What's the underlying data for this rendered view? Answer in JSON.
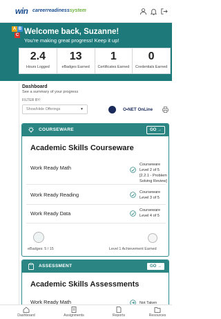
{
  "app": {
    "logo_primary": "win",
    "logo_secondary_left": "careerreadiness",
    "logo_secondary_right": "system"
  },
  "top_icons": [
    "user-icon",
    "bell-icon",
    "logout-icon"
  ],
  "welcome": {
    "title": "Welcome back, Suzanne!",
    "subtitle": "You're making great progress! Keep it up!",
    "blocks": [
      "A",
      "B",
      "C"
    ]
  },
  "stats": [
    {
      "value": "2.4",
      "label": "Hours Logged"
    },
    {
      "value": "13",
      "label": "eBadges Earned"
    },
    {
      "value": "1",
      "label": "Certificates Earned"
    },
    {
      "value": "0",
      "label": "Credentials Earned"
    }
  ],
  "dashboard": {
    "title": "Dashboard",
    "subtitle": "See a summary of your progress",
    "filter_label": "FILTER BY:",
    "filter_placeholder": "Show/Hide Offerings",
    "onet_label": "O•NET OnLine"
  },
  "courseware": {
    "header": "COURSEWARE",
    "go_label": "GO →",
    "title": "Academic Skills Courseware",
    "rows": [
      {
        "name": "Work Ready Math",
        "status": "Courseware Level 2 of 5 [2.2.1 - Problem Solving Review]"
      },
      {
        "name": "Work Ready Reading",
        "status": "Courseware Level 3 of 5"
      },
      {
        "name": "Work Ready Data",
        "status": "Courseware Level 4 of 5"
      }
    ],
    "ebadges_label": "eBadges: 5 / 15",
    "achievement_label": "Level 1 Achievement Earned"
  },
  "assessment": {
    "header": "ASSESSMENT",
    "go_label": "GO →",
    "title": "Academic Skills Assessments",
    "rows": [
      {
        "name": "Work Ready Math",
        "status": "Not Taken"
      }
    ]
  },
  "bottom_nav": [
    {
      "label": "Dashboard",
      "icon": "home-icon"
    },
    {
      "label": "Assignments",
      "icon": "assignments-icon"
    },
    {
      "label": "Reports",
      "icon": "reports-icon"
    },
    {
      "label": "Resources",
      "icon": "resources-icon"
    }
  ],
  "colors": {
    "teal": "#2b8583",
    "welcome_bg": "#1e7a7a",
    "brand_blue": "#1a4d8f",
    "brand_green": "#6bb33e"
  }
}
